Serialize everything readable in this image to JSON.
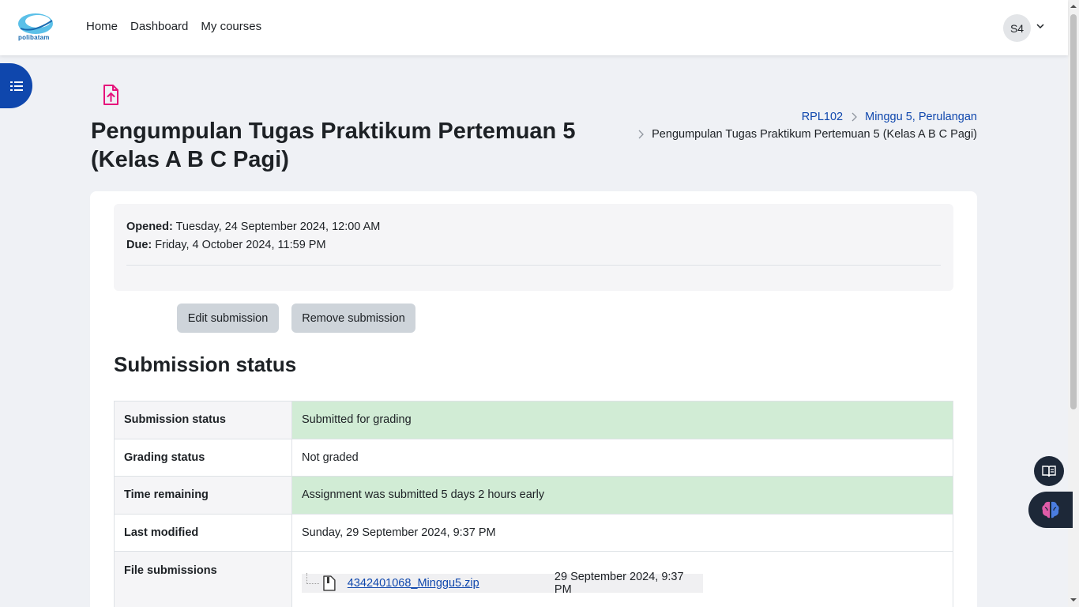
{
  "navbar": {
    "logo_text": "polibatam",
    "links": [
      "Home",
      "Dashboard",
      "My courses"
    ],
    "avatar_initials": "S4"
  },
  "page": {
    "title": "Pengumpulan Tugas Praktikum Pertemuan 5 (Kelas A B C Pagi)",
    "breadcrumb": [
      "RPL102",
      "Minggu 5, Perulangan",
      "Pengumpulan Tugas Praktikum Pertemuan 5 (Kelas A B C Pagi)"
    ]
  },
  "dates": {
    "opened_label": "Opened:",
    "opened_value": "Tuesday, 24 September 2024, 12:00 AM",
    "due_label": "Due:",
    "due_value": "Friday, 4 October 2024, 11:59 PM"
  },
  "actions": {
    "edit": "Edit submission",
    "remove": "Remove submission"
  },
  "submission": {
    "heading": "Submission status",
    "rows": [
      {
        "label": "Submission status",
        "value": "Submitted for grading"
      },
      {
        "label": "Grading status",
        "value": "Not graded"
      },
      {
        "label": "Time remaining",
        "value": "Assignment was submitted 5 days 2 hours early"
      },
      {
        "label": "Last modified",
        "value": "Sunday, 29 September 2024, 9:37 PM"
      },
      {
        "label": "File submissions",
        "file_name": "4342401068_Minggu5.zip",
        "file_date": "29 September 2024, 9:37 PM"
      }
    ]
  },
  "colors": {
    "brand": "#0f47ad",
    "success_bg": "#d1ecd5",
    "activity_icon": "#e6137b"
  },
  "icons": {
    "drawer": "list-icon",
    "activity": "file-upload-icon",
    "floating_1": "book-icon",
    "floating_2": "brain-icon"
  }
}
